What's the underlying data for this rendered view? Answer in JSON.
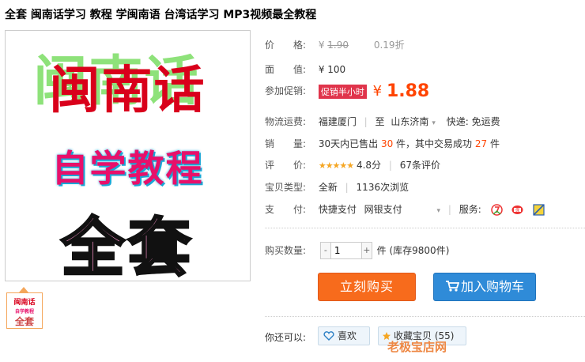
{
  "product": {
    "title": "全套 闽南话学习 教程 学闽南语 台湾话学习 MP3视频最全教程"
  },
  "main_image": {
    "line1_shadow": "闽南话",
    "line1": "闽南话",
    "line2": "自学教程",
    "line3": "全套"
  },
  "thumbnail": {
    "line1": "闽南话",
    "line2": "自学教程",
    "line3": "全套"
  },
  "info": {
    "price_label": "价　　格:",
    "price_yen": "¥",
    "price_original": "1.90",
    "price_discount": "0.19折",
    "face_label": "面　　值:",
    "face_value": "¥ 100",
    "promo_label": "参加促销:",
    "promo_tag": "促销半小时",
    "promo_yen": "¥",
    "promo_price": "1.88",
    "shipping_label": "物流运费:",
    "ship_from": "福建厦门",
    "ship_to_prefix": "至",
    "ship_to": "山东济南",
    "ship_fee": "快递: 免运费",
    "sales_label": "销　　量:",
    "sales_prefix": "30天内已售出",
    "sales_count": "30",
    "sales_mid": "件，其中交易成功",
    "sales_success": "27",
    "sales_suffix": "件",
    "rating_label": "评　　价:",
    "rating_stars": "★★★★★",
    "rating_score": "4.8分",
    "rating_count": "67条评价",
    "type_label": "宝贝类型:",
    "type_value": "全新",
    "views": "1136次浏览",
    "pay_label": "支　　付:",
    "pay_quick": "快捷支付",
    "pay_bank": "网银支付",
    "service_label": "服务:"
  },
  "purchase": {
    "qty_label": "购买数量:",
    "qty_minus": "-",
    "qty_value": "1",
    "qty_plus": "+",
    "qty_stock": "件 (库存9800件)",
    "buy_now": "立刻购买",
    "add_cart": "加入购物车"
  },
  "social": {
    "label": "你还可以:",
    "like": "喜欢",
    "collect": "收藏宝贝 (55)",
    "store_partial": "老极宝店网"
  },
  "colors": {
    "price_orange": "#ff4400",
    "buy_button": "#f76b1c",
    "cart_button": "#2f8bd8",
    "promo_tag": "#e0344b"
  }
}
